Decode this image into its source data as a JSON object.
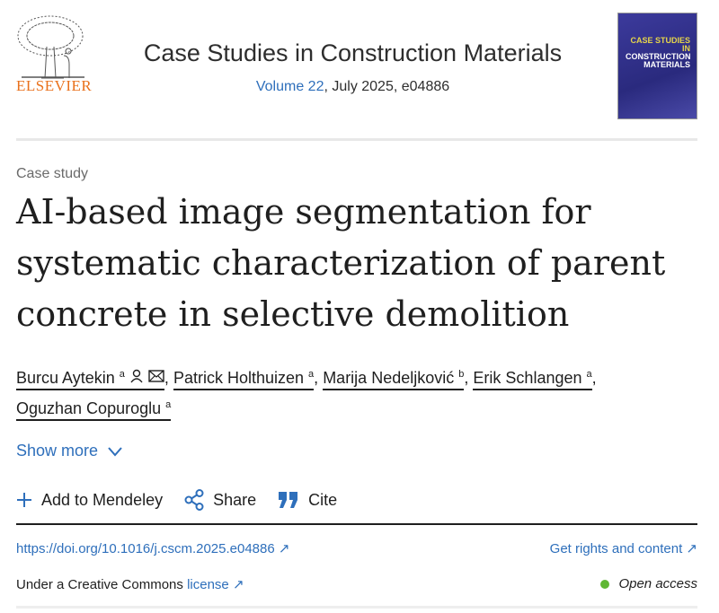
{
  "header": {
    "publisher": "ELSEVIER",
    "journal_title": "Case Studies in Construction Materials",
    "volume_link": "Volume 22",
    "issue_info": ", July 2025, e04886",
    "cover_text": [
      "CASE STUDIES IN",
      "CONSTRUCTION",
      "MATERIALS"
    ]
  },
  "article": {
    "type": "Case study",
    "title": "AI-based image segmentation for systematic characterization of parent concrete in selective demolition",
    "authors": [
      {
        "name": "Burcu Aytekin",
        "aff": "a"
      },
      {
        "name": "Patrick Holthuizen",
        "aff": "a"
      },
      {
        "name": "Marija Nedeljković",
        "aff": "b"
      },
      {
        "name": "Erik Schlangen",
        "aff": "a"
      },
      {
        "name": "Oguzhan Copuroglu",
        "aff": "a"
      }
    ],
    "sep": ",",
    "show_more": "Show more"
  },
  "actions": {
    "mendeley": "Add to Mendeley",
    "share": "Share",
    "cite": "Cite"
  },
  "links": {
    "doi": "https://doi.org/10.1016/j.cscm.2025.e04886",
    "rights": "Get rights and content",
    "license_prefix": "Under a Creative Commons ",
    "license_link": "license",
    "open_access": "Open access",
    "ext": "↗"
  },
  "colors": {
    "link": "#2e6fbb",
    "brand": "#e9711c",
    "open_access": "#5fb733"
  }
}
